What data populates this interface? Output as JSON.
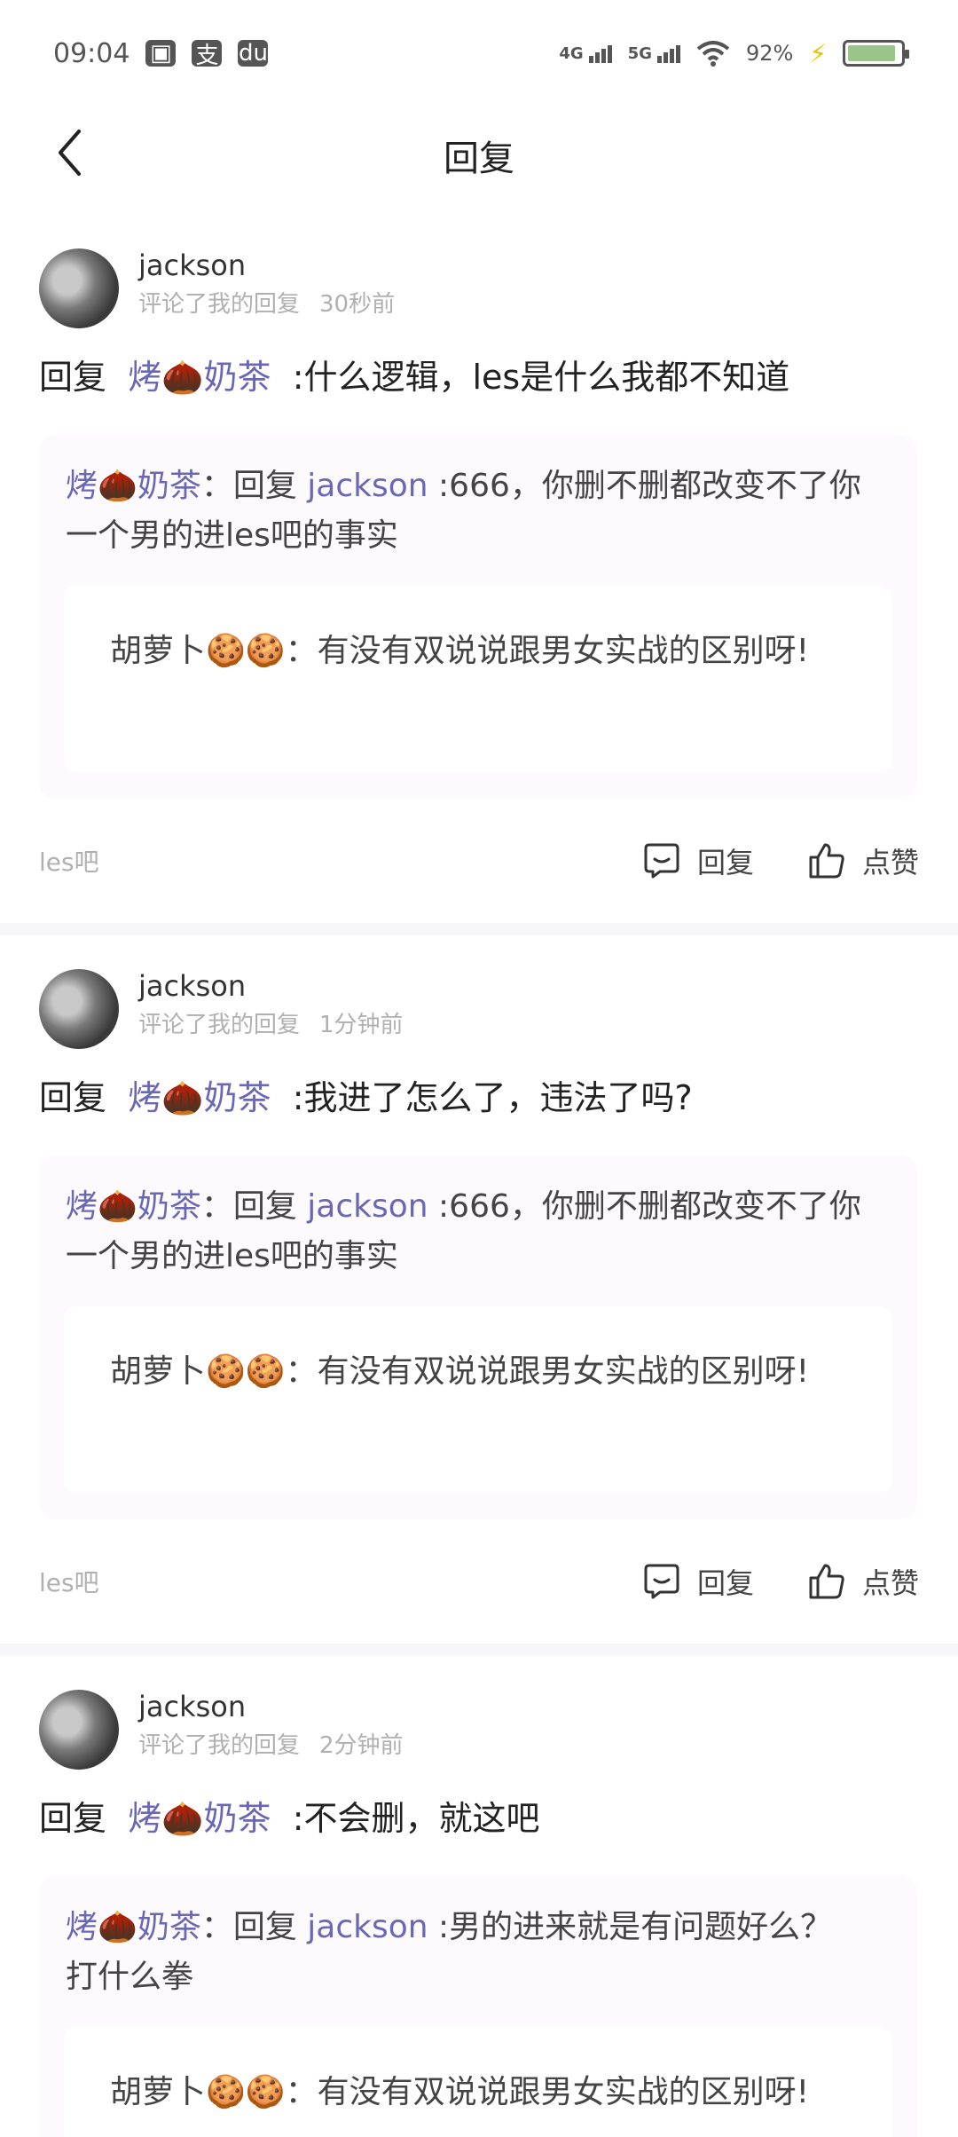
{
  "status_bar": {
    "time": "09:04",
    "app_icons": [
      "bilibili-icon",
      "alipay-icon",
      "dewu-icon"
    ],
    "app_glyphs": [
      "▣",
      "支",
      "du"
    ],
    "network": [
      "4G",
      "5G"
    ],
    "battery_text": "92%",
    "battery_level": 0.92,
    "battery_color": "#9bc48b"
  },
  "header": {
    "title": "回复"
  },
  "comments": [
    {
      "user": "jackson",
      "action_text": "评论了我的回复",
      "time": "30秒前",
      "reply_prefix": "回复",
      "reply_to": "烤🌰奶茶",
      "reply_body": ":什么逻辑，les是什么我都不知道",
      "quote": {
        "author": "烤🌰奶茶",
        "sep": "：回复 ",
        "target": "jackson",
        "text": ":666，你删不删都改变不了你一个男的进les吧的事实"
      },
      "inner": {
        "author": "胡萝卜🍪🍪",
        "text": "：有没有双说说跟男女实战的区别呀!"
      },
      "source": "les吧",
      "reply_label": "回复",
      "like_label": "点赞"
    },
    {
      "user": "jackson",
      "action_text": "评论了我的回复",
      "time": "1分钟前",
      "reply_prefix": "回复",
      "reply_to": "烤🌰奶茶",
      "reply_body": ":我进了怎么了，违法了吗?",
      "quote": {
        "author": "烤🌰奶茶",
        "sep": "：回复 ",
        "target": "jackson",
        "text": ":666，你删不删都改变不了你一个男的进les吧的事实"
      },
      "inner": {
        "author": "胡萝卜🍪🍪",
        "text": "：有没有双说说跟男女实战的区别呀!"
      },
      "source": "les吧",
      "reply_label": "回复",
      "like_label": "点赞"
    },
    {
      "user": "jackson",
      "action_text": "评论了我的回复",
      "time": "2分钟前",
      "reply_prefix": "回复",
      "reply_to": "烤🌰奶茶",
      "reply_body": ":不会删，就这吧",
      "quote": {
        "author": "烤🌰奶茶",
        "sep": "：回复 ",
        "target": "jackson",
        "text": ":男的进来就是有问题好么？打什么拳"
      },
      "inner": {
        "author": "胡萝卜🍪🍪",
        "text": "：有没有双说说跟男女实战的区别呀!"
      }
    }
  ]
}
